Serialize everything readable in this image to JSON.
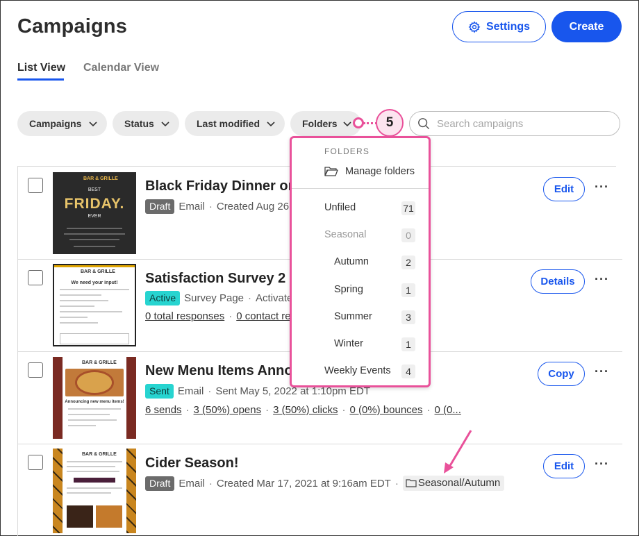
{
  "header": {
    "title": "Campaigns",
    "settings_label": "Settings",
    "create_label": "Create"
  },
  "tabs": [
    {
      "label": "List View",
      "active": true
    },
    {
      "label": "Calendar View",
      "active": false
    }
  ],
  "filters": [
    {
      "label": "Campaigns"
    },
    {
      "label": "Status"
    },
    {
      "label": "Last modified"
    },
    {
      "label": "Folders"
    }
  ],
  "callout": {
    "number": "5"
  },
  "search": {
    "placeholder": "Search campaigns"
  },
  "campaigns": [
    {
      "title": "Black Friday Dinner or",
      "status": "Draft",
      "type": "Email",
      "detail": "Created Aug 26,",
      "action": "Edit",
      "thumb_text": {
        "top": "BEST",
        "main": "FRIDAY.",
        "bottom": "EVER"
      }
    },
    {
      "title": "Satisfaction Survey 2",
      "status": "Active",
      "type": "Survey Page",
      "detail": "Activate",
      "links": [
        "0 total responses",
        "0 contact res"
      ],
      "action": "Details",
      "thumb_text": {
        "heading": "We need your input!"
      }
    },
    {
      "title": "New Menu Items Anno",
      "status": "Sent",
      "type": "Email",
      "detail": "Sent May 5, 2022 at 1:10pm EDT",
      "links": [
        "6 sends",
        "3 (50%) opens",
        "3 (50%) clicks",
        "0 (0%) bounces",
        "0 (0..."
      ],
      "action": "Copy",
      "thumb_text": {
        "heading": "Announcing new menu items!"
      }
    },
    {
      "title": "Cider Season!",
      "status": "Draft",
      "type": "Email",
      "detail": "Created Mar 17, 2021 at 9:16am EDT",
      "folder": "Seasonal/Autumn",
      "action": "Edit"
    }
  ],
  "brand_mark": "BAR & GRILLE",
  "folders_dropdown": {
    "heading": "FOLDERS",
    "manage_label": "Manage folders",
    "items": [
      {
        "label": "Unfiled",
        "count": "71"
      },
      {
        "label": "Seasonal",
        "count": "0"
      },
      {
        "label": "Autumn",
        "count": "2"
      },
      {
        "label": "Spring",
        "count": "1"
      },
      {
        "label": "Summer",
        "count": "3"
      },
      {
        "label": "Winter",
        "count": "1"
      },
      {
        "label": "Weekly Events",
        "count": "4"
      }
    ]
  },
  "colors": {
    "primary": "#1856ed",
    "highlight": "#e9519a",
    "active_badge": "#27d4d0",
    "draft_badge": "#6b6b6b"
  }
}
